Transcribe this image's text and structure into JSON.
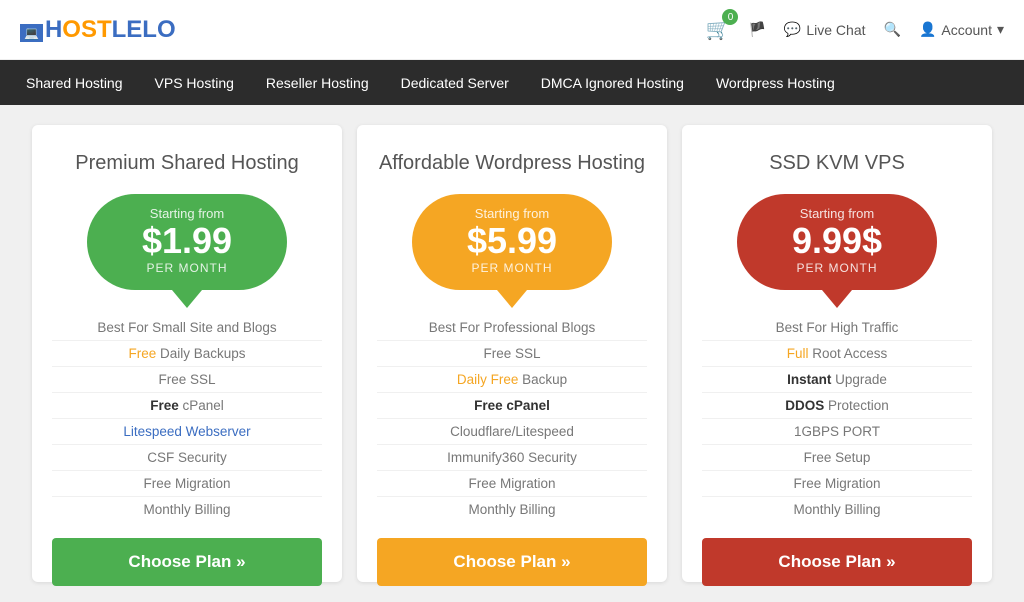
{
  "header": {
    "logo_prefix": "H",
    "logo_text": "OSTLELO",
    "cart_badge": "0",
    "flag_icon": "🏴",
    "live_chat_label": "Live Chat",
    "search_icon": "🔍",
    "account_label": "Account"
  },
  "nav": {
    "items": [
      {
        "label": "Shared Hosting"
      },
      {
        "label": "VPS Hosting"
      },
      {
        "label": "Reseller Hosting"
      },
      {
        "label": "Dedicated Server"
      },
      {
        "label": "DMCA Ignored Hosting"
      },
      {
        "label": "Wordpress Hosting"
      }
    ]
  },
  "cards": [
    {
      "title": "Premium Shared Hosting",
      "bubble_color": "green",
      "starting_from": "Starting from",
      "price": "$1.99",
      "period": "PER MONTH",
      "features": [
        {
          "text": "Best For Small Site and Blogs",
          "style": "normal"
        },
        {
          "prefix": "Free",
          "prefix_style": "orange",
          "suffix": " Daily Backups"
        },
        {
          "text": "Free SSL",
          "style": "normal"
        },
        {
          "prefix": "Free",
          "prefix_style": "bold",
          "suffix": " cPanel"
        },
        {
          "text": "Litespeed Webserver",
          "prefix_style": "blue",
          "full_blue": true
        },
        {
          "text": "CSF Security",
          "style": "normal"
        },
        {
          "text": "Free Migration",
          "style": "normal"
        },
        {
          "text": "Monthly Billing",
          "style": "normal"
        }
      ],
      "btn_color": "green",
      "btn_label": "Choose Plan »"
    },
    {
      "title": "Affordable Wordpress Hosting",
      "bubble_color": "orange",
      "starting_from": "Starting from",
      "price": "$5.99",
      "period": "PER MONTH",
      "features": [
        {
          "text": "Best For Professional Blogs",
          "style": "normal"
        },
        {
          "text": "Free SSL",
          "style": "normal"
        },
        {
          "prefix": "Daily Free",
          "prefix_style": "orange",
          "suffix": " Backup"
        },
        {
          "prefix": "Free cPanel",
          "prefix_style": "bold",
          "suffix": ""
        },
        {
          "text": "Cloudflare/Litespeed",
          "style": "normal"
        },
        {
          "text": "Immunify360 Security",
          "style": "normal"
        },
        {
          "text": "Free Migration",
          "style": "normal"
        },
        {
          "text": "Monthly Billing",
          "style": "normal"
        }
      ],
      "btn_color": "orange",
      "btn_label": "Choose Plan »"
    },
    {
      "title": "SSD KVM VPS",
      "bubble_color": "red",
      "starting_from": "Starting from",
      "price": "9.99$",
      "period": "PER MONTH",
      "features": [
        {
          "text": "Best For High Traffic",
          "style": "normal"
        },
        {
          "prefix": "Full",
          "prefix_style": "orange",
          "suffix": " Root Access"
        },
        {
          "prefix": "Instant",
          "prefix_style": "bold",
          "suffix": " Upgrade"
        },
        {
          "prefix": "DDOS",
          "prefix_style": "bold",
          "suffix": " Protection"
        },
        {
          "text": "1GBPS PORT",
          "style": "normal"
        },
        {
          "text": "Free Setup",
          "style": "normal"
        },
        {
          "text": "Free Migration",
          "style": "normal"
        },
        {
          "text": "Monthly Billing",
          "style": "normal"
        }
      ],
      "btn_color": "red",
      "btn_label": "Choose Plan »"
    }
  ]
}
